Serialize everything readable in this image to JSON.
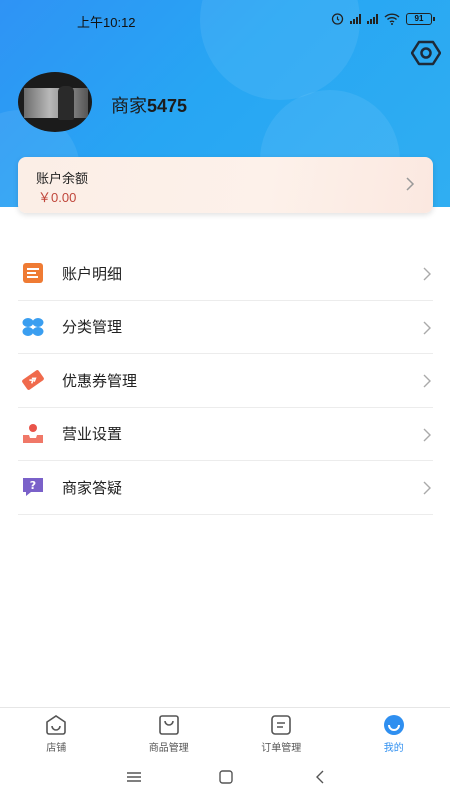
{
  "status_bar": {
    "time": "上午10:12",
    "battery": "91"
  },
  "header": {
    "merchant_name_prefix": "商家",
    "merchant_name_number": "5475"
  },
  "balance": {
    "label": "账户余额",
    "value": "￥0.00"
  },
  "menu": [
    {
      "label": "账户明细",
      "icon": "ledger-icon"
    },
    {
      "label": "分类管理",
      "icon": "category-icon"
    },
    {
      "label": "优惠券管理",
      "icon": "coupon-icon"
    },
    {
      "label": "营业设置",
      "icon": "business-settings-icon"
    },
    {
      "label": "商家答疑",
      "icon": "faq-icon"
    }
  ],
  "tabs": [
    {
      "label": "店铺",
      "icon": "shop-icon",
      "active": false
    },
    {
      "label": "商品管理",
      "icon": "goods-icon",
      "active": false
    },
    {
      "label": "订单管理",
      "icon": "order-icon",
      "active": false
    },
    {
      "label": "我的",
      "icon": "profile-icon",
      "active": true
    }
  ],
  "colors": {
    "header": "#2f93f5",
    "accent": "#2f8ff0",
    "price": "#c0463b"
  }
}
